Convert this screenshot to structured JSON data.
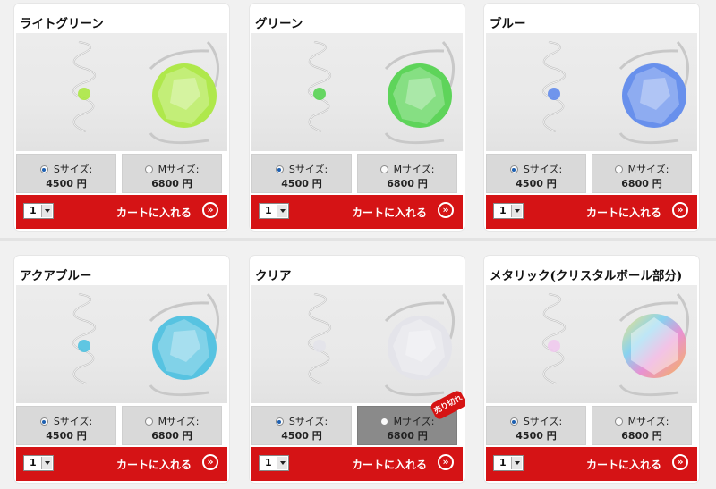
{
  "products": [
    {
      "name": "ライトグリーン",
      "color": "#a8e83a",
      "s_label": "Sサイズ:",
      "s_price": "4500 円",
      "m_label": "Mサイズ:",
      "m_price": "6800 円",
      "selected": "S",
      "sold_out": false,
      "qty": "1",
      "cart_label": "カートに入れる"
    },
    {
      "name": "グリーン",
      "color": "#4fd24a",
      "s_label": "Sサイズ:",
      "s_price": "4500 円",
      "m_label": "Mサイズ:",
      "m_price": "6800 円",
      "selected": "S",
      "sold_out": false,
      "qty": "1",
      "cart_label": "カートに入れる"
    },
    {
      "name": "ブルー",
      "color": "#5a86ec",
      "s_label": "Sサイズ:",
      "s_price": "4500 円",
      "m_label": "Mサイズ:",
      "m_price": "6800 円",
      "selected": "S",
      "sold_out": false,
      "qty": "1",
      "cart_label": "カートに入れる"
    },
    {
      "name": "アクアブルー",
      "color": "#47bfe0",
      "s_label": "Sサイズ:",
      "s_price": "4500 円",
      "m_label": "Mサイズ:",
      "m_price": "6800 円",
      "selected": "S",
      "sold_out": false,
      "qty": "1",
      "cart_label": "カートに入れる"
    },
    {
      "name": "クリア",
      "color": "#e3e3ea",
      "s_label": "Sサイズ:",
      "s_price": "4500 円",
      "m_label": "Mサイズ:",
      "m_price": "6800 円",
      "selected": "S",
      "sold_out": true,
      "sold_out_label": "売り切れ",
      "qty": "1",
      "cart_label": "カートに入れる"
    },
    {
      "name": "メタリック(クリスタルボール部分)",
      "color": "#f4d35a",
      "s_label": "Sサイズ:",
      "s_price": "4500 円",
      "m_label": "Mサイズ:",
      "m_price": "6800 円",
      "selected": "S",
      "sold_out": false,
      "qty": "1",
      "cart_label": "カートに入れる"
    }
  ],
  "icons": {
    "go": "chevron-right-circle-icon",
    "qty_arrow": "chevron-down-icon"
  },
  "colors": {
    "cart_bar": "#d51315",
    "sold_out_bg": "#8a8a8a",
    "badge": "#d61313"
  }
}
